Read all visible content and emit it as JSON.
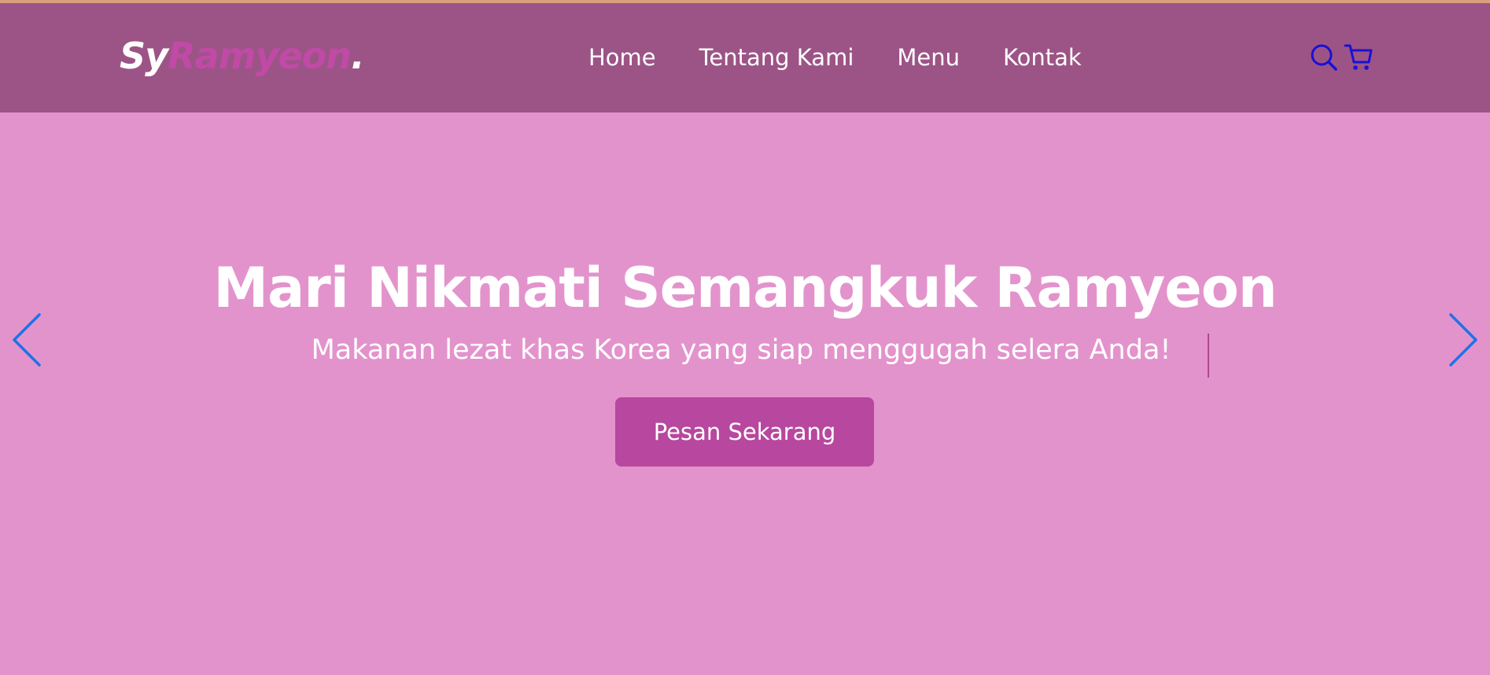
{
  "navbar": {
    "logo": {
      "part1": "Sy",
      "part2": "Ramyeon",
      "part3": "."
    },
    "links": [
      "Home",
      "Tentang Kami",
      "Menu",
      "Kontak"
    ],
    "icons": [
      "search-icon",
      "cart-icon"
    ],
    "background": "#9c5486",
    "icon_color": "#1a10d6"
  },
  "hero": {
    "title": "Mari Nikmati Semangkuk Ramyeon",
    "subtitle": "Makanan lezat khas Korea yang siap menggugah selera Anda!",
    "cta_label": "Pesan Sekarang",
    "background": "#e393cc",
    "cta_color": "#b8479f",
    "arrow_color": "#1f72e8"
  }
}
